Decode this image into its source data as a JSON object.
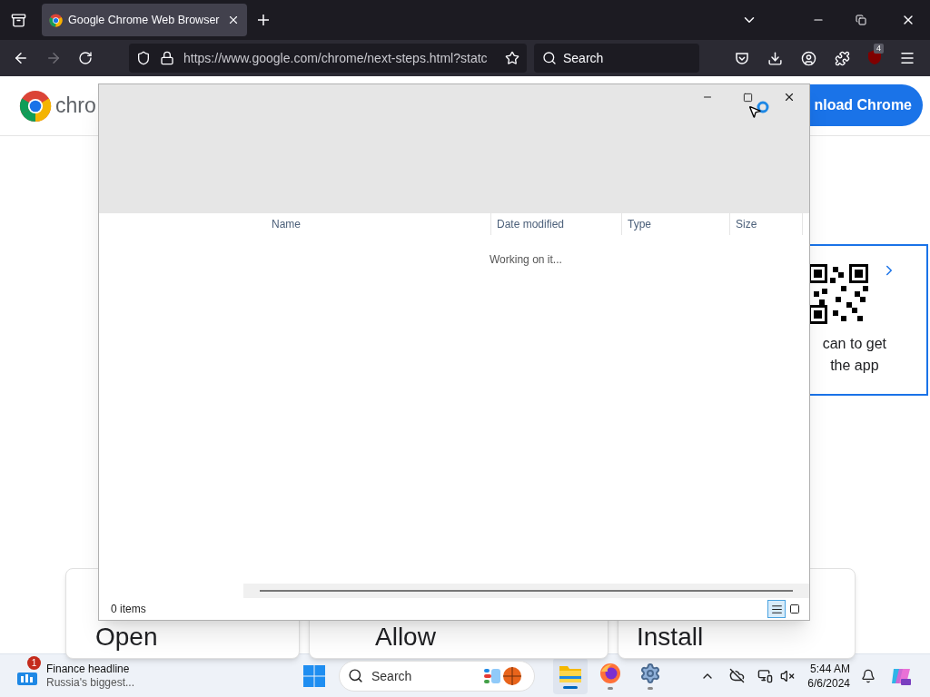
{
  "browser": {
    "tabs": [
      {
        "title": "Google Chrome Web Browser",
        "selected": true
      }
    ],
    "forward_disabled": true,
    "url": "https://www.google.com/chrome/next-steps.html?statc",
    "search": {
      "placeholder": "Search"
    },
    "extension_badge": "4"
  },
  "page": {
    "logo_text": "chro",
    "download_button": "nload Chrome",
    "qr_card": {
      "lines": [
        "can to get",
        "the app"
      ]
    },
    "steps": [
      "Open",
      "Allow",
      "Install"
    ]
  },
  "dialog": {
    "columns": [
      {
        "label": "Name"
      },
      {
        "label": "Date modified"
      },
      {
        "label": "Type"
      },
      {
        "label": "Size"
      }
    ],
    "status_message": "Working on it...",
    "item_count": "0 items",
    "views": [
      {
        "kind": "details",
        "selected": true
      },
      {
        "kind": "tiles",
        "selected": false
      }
    ]
  },
  "taskbar": {
    "widget": {
      "badge": "1",
      "title": "Finance headline",
      "subtitle": "Russia's biggest..."
    },
    "search": {
      "placeholder": "Search"
    },
    "apps": [
      {
        "kind": "explorer",
        "selected": true
      },
      {
        "kind": "firefox",
        "selected": false
      },
      {
        "kind": "settings",
        "selected": false
      }
    ],
    "time": "5:44 AM",
    "date": "6/6/2024"
  }
}
